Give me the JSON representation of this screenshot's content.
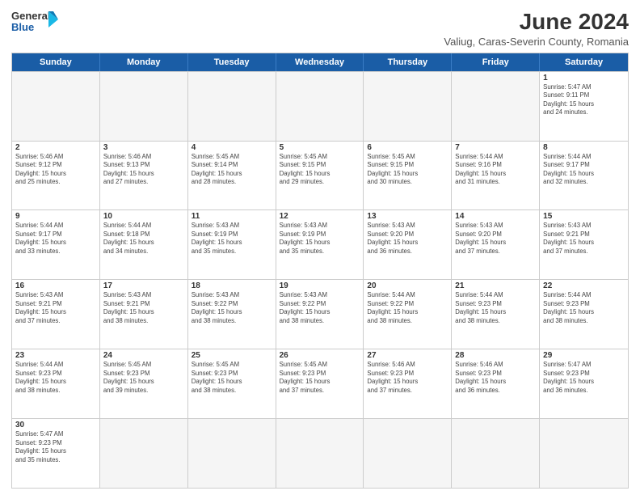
{
  "logo": {
    "line1": "General",
    "line2": "Blue"
  },
  "title": "June 2024",
  "subtitle": "Valiug, Caras-Severin County, Romania",
  "days_of_week": [
    "Sunday",
    "Monday",
    "Tuesday",
    "Wednesday",
    "Thursday",
    "Friday",
    "Saturday"
  ],
  "weeks": [
    [
      {
        "day": "",
        "empty": true
      },
      {
        "day": "",
        "empty": true
      },
      {
        "day": "",
        "empty": true
      },
      {
        "day": "",
        "empty": true
      },
      {
        "day": "",
        "empty": true
      },
      {
        "day": "",
        "empty": true
      },
      {
        "day": "1",
        "info": "Sunrise: 5:47 AM\nSunset: 9:11 PM\nDaylight: 15 hours\nand 24 minutes."
      }
    ],
    [
      {
        "day": "2",
        "info": "Sunrise: 5:46 AM\nSunset: 9:12 PM\nDaylight: 15 hours\nand 25 minutes."
      },
      {
        "day": "3",
        "info": "Sunrise: 5:46 AM\nSunset: 9:13 PM\nDaylight: 15 hours\nand 27 minutes."
      },
      {
        "day": "4",
        "info": "Sunrise: 5:45 AM\nSunset: 9:14 PM\nDaylight: 15 hours\nand 28 minutes."
      },
      {
        "day": "5",
        "info": "Sunrise: 5:45 AM\nSunset: 9:15 PM\nDaylight: 15 hours\nand 29 minutes."
      },
      {
        "day": "6",
        "info": "Sunrise: 5:45 AM\nSunset: 9:15 PM\nDaylight: 15 hours\nand 30 minutes."
      },
      {
        "day": "7",
        "info": "Sunrise: 5:44 AM\nSunset: 9:16 PM\nDaylight: 15 hours\nand 31 minutes."
      },
      {
        "day": "8",
        "info": "Sunrise: 5:44 AM\nSunset: 9:17 PM\nDaylight: 15 hours\nand 32 minutes."
      }
    ],
    [
      {
        "day": "9",
        "info": "Sunrise: 5:44 AM\nSunset: 9:17 PM\nDaylight: 15 hours\nand 33 minutes."
      },
      {
        "day": "10",
        "info": "Sunrise: 5:44 AM\nSunset: 9:18 PM\nDaylight: 15 hours\nand 34 minutes."
      },
      {
        "day": "11",
        "info": "Sunrise: 5:43 AM\nSunset: 9:19 PM\nDaylight: 15 hours\nand 35 minutes."
      },
      {
        "day": "12",
        "info": "Sunrise: 5:43 AM\nSunset: 9:19 PM\nDaylight: 15 hours\nand 35 minutes."
      },
      {
        "day": "13",
        "info": "Sunrise: 5:43 AM\nSunset: 9:20 PM\nDaylight: 15 hours\nand 36 minutes."
      },
      {
        "day": "14",
        "info": "Sunrise: 5:43 AM\nSunset: 9:20 PM\nDaylight: 15 hours\nand 37 minutes."
      },
      {
        "day": "15",
        "info": "Sunrise: 5:43 AM\nSunset: 9:21 PM\nDaylight: 15 hours\nand 37 minutes."
      }
    ],
    [
      {
        "day": "16",
        "info": "Sunrise: 5:43 AM\nSunset: 9:21 PM\nDaylight: 15 hours\nand 37 minutes."
      },
      {
        "day": "17",
        "info": "Sunrise: 5:43 AM\nSunset: 9:21 PM\nDaylight: 15 hours\nand 38 minutes."
      },
      {
        "day": "18",
        "info": "Sunrise: 5:43 AM\nSunset: 9:22 PM\nDaylight: 15 hours\nand 38 minutes."
      },
      {
        "day": "19",
        "info": "Sunrise: 5:43 AM\nSunset: 9:22 PM\nDaylight: 15 hours\nand 38 minutes."
      },
      {
        "day": "20",
        "info": "Sunrise: 5:44 AM\nSunset: 9:22 PM\nDaylight: 15 hours\nand 38 minutes."
      },
      {
        "day": "21",
        "info": "Sunrise: 5:44 AM\nSunset: 9:23 PM\nDaylight: 15 hours\nand 38 minutes."
      },
      {
        "day": "22",
        "info": "Sunrise: 5:44 AM\nSunset: 9:23 PM\nDaylight: 15 hours\nand 38 minutes."
      }
    ],
    [
      {
        "day": "23",
        "info": "Sunrise: 5:44 AM\nSunset: 9:23 PM\nDaylight: 15 hours\nand 38 minutes."
      },
      {
        "day": "24",
        "info": "Sunrise: 5:45 AM\nSunset: 9:23 PM\nDaylight: 15 hours\nand 39 minutes."
      },
      {
        "day": "25",
        "info": "Sunrise: 5:45 AM\nSunset: 9:23 PM\nDaylight: 15 hours\nand 38 minutes."
      },
      {
        "day": "26",
        "info": "Sunrise: 5:45 AM\nSunset: 9:23 PM\nDaylight: 15 hours\nand 37 minutes."
      },
      {
        "day": "27",
        "info": "Sunrise: 5:46 AM\nSunset: 9:23 PM\nDaylight: 15 hours\nand 37 minutes."
      },
      {
        "day": "28",
        "info": "Sunrise: 5:46 AM\nSunset: 9:23 PM\nDaylight: 15 hours\nand 36 minutes."
      },
      {
        "day": "29",
        "info": "Sunrise: 5:47 AM\nSunset: 9:23 PM\nDaylight: 15 hours\nand 36 minutes."
      }
    ],
    [
      {
        "day": "30",
        "info": "Sunrise: 5:47 AM\nSunset: 9:23 PM\nDaylight: 15 hours\nand 35 minutes."
      },
      {
        "day": "",
        "empty": true
      },
      {
        "day": "",
        "empty": true
      },
      {
        "day": "",
        "empty": true
      },
      {
        "day": "",
        "empty": true
      },
      {
        "day": "",
        "empty": true
      },
      {
        "day": "",
        "empty": true
      }
    ]
  ]
}
